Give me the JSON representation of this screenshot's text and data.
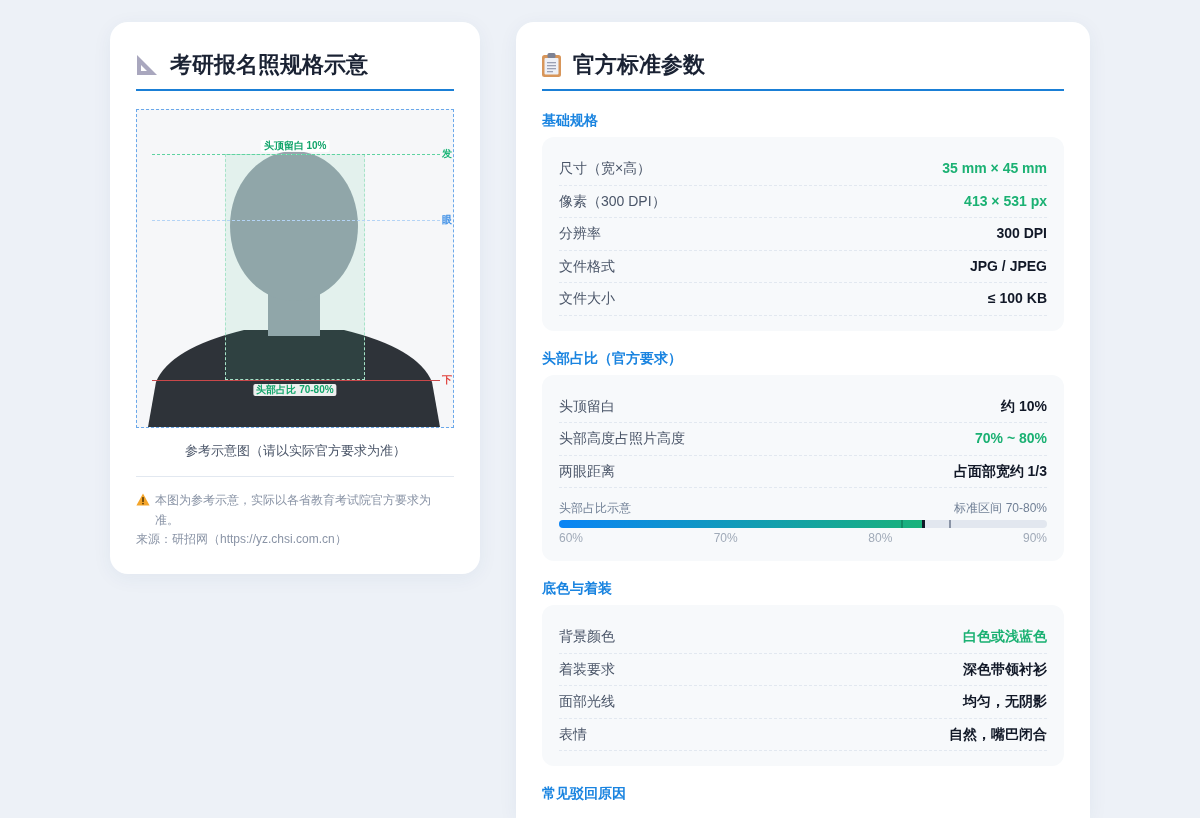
{
  "left_card": {
    "title": "考研报名照规格示意",
    "photo": {
      "top_margin_label": "头顶留白 10%",
      "head_ratio_label": "头部占比 70-80%",
      "side_labels": [
        {
          "kind": "hairline",
          "text": "发"
        },
        {
          "kind": "eye",
          "text": "眼"
        },
        {
          "kind": "chin",
          "text": "下"
        }
      ]
    },
    "caption": "参考示意图（请以实际官方要求为准）",
    "note": "本图为参考示意，实际以各省教育考试院官方要求为准。",
    "source": "来源：研招网（https://yz.chsi.com.cn）"
  },
  "right_card": {
    "title": "官方标准参数",
    "sections": [
      {
        "title": "基础规格",
        "rows": [
          {
            "label": "尺寸（宽×高）",
            "value": "35 mm × 45 mm",
            "highlight": true
          },
          {
            "label": "像素（300 DPI）",
            "value": "413 × 531 px",
            "highlight": true
          },
          {
            "label": "分辨率",
            "value": "300 DPI",
            "highlight": false
          },
          {
            "label": "文件格式",
            "value": "JPG / JPEG",
            "highlight": false
          },
          {
            "label": "文件大小",
            "value": "≤ 100 KB",
            "highlight": false
          }
        ]
      },
      {
        "title": "头部占比（官方要求）",
        "rows": [
          {
            "label": "头顶留白",
            "value": "约 10%",
            "highlight": false
          },
          {
            "label": "头部高度占照片高度",
            "value": "70% ~ 80%",
            "highlight": true
          },
          {
            "label": "两眼距离",
            "value": "占面部宽约 1/3",
            "highlight": false
          }
        ],
        "meter": {
          "label": "头部占比示意",
          "range_label": "标准区间 70-80%",
          "level": 0.75,
          "ticks": [
            "60%",
            "70%",
            "80%",
            "90%"
          ]
        }
      },
      {
        "title": "底色与着装",
        "rows": [
          {
            "label": "背景颜色",
            "value": "白色或浅蓝色",
            "highlight": true
          },
          {
            "label": "着装要求",
            "value": "深色带领衬衫",
            "highlight": false
          },
          {
            "label": "面部光线",
            "value": "均匀，无阴影",
            "highlight": false
          },
          {
            "label": "表情",
            "value": "自然，嘴巴闭合",
            "highlight": false
          }
        ]
      },
      {
        "title": "常见驳回原因"
      }
    ]
  }
}
